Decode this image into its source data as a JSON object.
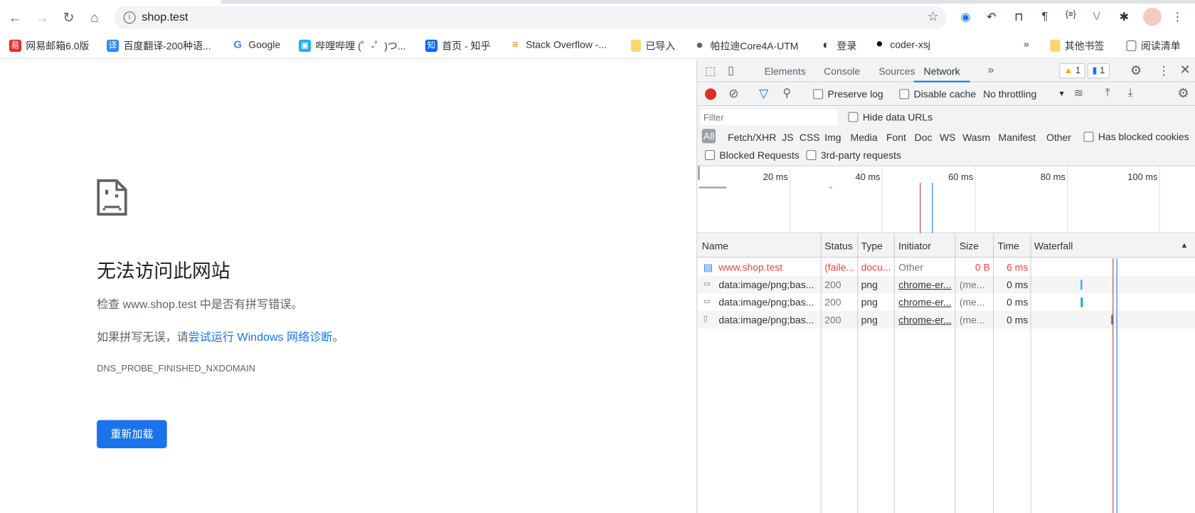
{
  "browser": {
    "url": "shop.test",
    "nav_icons": [
      "back-icon",
      "forward-icon",
      "reload-icon",
      "home-icon"
    ],
    "extensions": [
      "extension-1-icon",
      "extension-2-icon",
      "bookmark-icon",
      "paragraph-icon",
      "json-icon",
      "vue-icon",
      "puzzle-icon",
      "avatar",
      "menu-icon"
    ]
  },
  "bookmarks": {
    "items": [
      {
        "label": "网易邮箱6.0版",
        "icon": "易",
        "color": "#e52e2e"
      },
      {
        "label": "百度翻译-200种语...",
        "icon": "译",
        "color": "#2d8cf0"
      },
      {
        "label": "Google",
        "icon": "G",
        "color": "#4285f4"
      },
      {
        "label": "哔哩哔哩 (゜-゜)つ...",
        "icon": "▣",
        "color": "#23ade5"
      },
      {
        "label": "首页 - 知乎",
        "icon": "知",
        "color": "#0066ff"
      },
      {
        "label": "Stack Overflow -...",
        "icon": "≡",
        "color": "#f48024"
      },
      {
        "label": "已导入",
        "icon": "",
        "color": "#fbd66a"
      },
      {
        "label": "帕拉迪Core4A-UTM",
        "icon": "●",
        "color": "#5f6368"
      },
      {
        "label": "登录",
        "icon": "◐",
        "color": "#333333"
      },
      {
        "label": "coder-xsj",
        "icon": "●",
        "color": "#111111"
      }
    ],
    "more": "»",
    "other": "其他书签",
    "reading": "阅读清单"
  },
  "error_page": {
    "title": "无法访问此网站",
    "check_prefix": "检查 ",
    "check_host": "www.shop.test",
    "check_suffix": " 中是否有拼写错误。",
    "line2_prefix": "如果拼写无误，请",
    "line2_link": "尝试运行 Windows 网络诊断",
    "line2_suffix": "。",
    "code": "DNS_PROBE_FINISHED_NXDOMAIN",
    "reload": "重新加载"
  },
  "devtools": {
    "tabs": [
      "Elements",
      "Console",
      "Sources",
      "Network"
    ],
    "active_tab": "Network",
    "more": "»",
    "warnings": "1",
    "messages": "1",
    "preserve_log": "Preserve log",
    "disable_cache": "Disable cache",
    "throttling": "No throttling",
    "filter_placeholder": "Filter",
    "hide_data_urls": "Hide data URLs",
    "types": [
      "All",
      "Fetch/XHR",
      "JS",
      "CSS",
      "Img",
      "Media",
      "Font",
      "Doc",
      "WS",
      "Wasm",
      "Manifest",
      "Other"
    ],
    "has_blocked_cookies": "Has blocked cookies",
    "blocked_requests": "Blocked Requests",
    "third_party": "3rd-party requests",
    "timeline_ticks": [
      "20 ms",
      "40 ms",
      "60 ms",
      "80 ms",
      "100 ms"
    ],
    "columns": [
      "Name",
      "Status",
      "Type",
      "Initiator",
      "Size",
      "Time",
      "Waterfall"
    ],
    "rows": [
      {
        "name": "www.shop.test",
        "status": "(faile...",
        "type": "docu...",
        "initiator": "Other",
        "size": "0 B",
        "time": "6 ms",
        "failed": true
      },
      {
        "name": "data:image/png;bas...",
        "status": "200",
        "type": "png",
        "initiator": "chrome-er...",
        "size": "(me...",
        "time": "0 ms",
        "failed": false
      },
      {
        "name": "data:image/png;bas...",
        "status": "200",
        "type": "png",
        "initiator": "chrome-er...",
        "size": "(me...",
        "time": "0 ms",
        "failed": false
      },
      {
        "name": "data:image/png;bas...",
        "status": "200",
        "type": "png",
        "initiator": "chrome-er...",
        "size": "(me...",
        "time": "0 ms",
        "failed": false
      }
    ],
    "colors": {
      "accent": "#1a73e8",
      "error": "#e8453c",
      "record": "#d93025"
    }
  }
}
